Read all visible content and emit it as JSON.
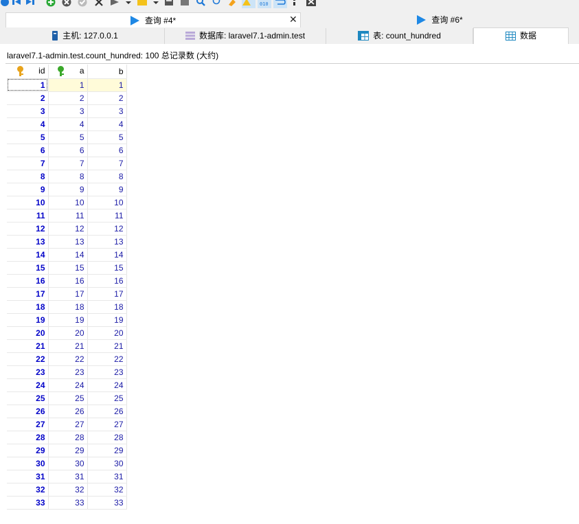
{
  "query_tabs": [
    {
      "label": "查询 #4*",
      "active": true
    },
    {
      "label": "查询 #6*",
      "active": false
    }
  ],
  "info_tabs": [
    {
      "label": "主机: 127.0.0.1",
      "icon": "server-icon"
    },
    {
      "label": "数据库: laravel7.1-admin.test",
      "icon": "database-icon"
    },
    {
      "label": "表: count_hundred",
      "icon": "table-icon"
    },
    {
      "label": "数据",
      "icon": "grid-icon",
      "active": true
    }
  ],
  "status_text": "laravel7.1-admin.test.count_hundred: 100 总记录数 (大约)",
  "columns": [
    "id",
    "a",
    "b"
  ],
  "rows": [
    [
      "1",
      "1",
      "1"
    ],
    [
      "2",
      "2",
      "2"
    ],
    [
      "3",
      "3",
      "3"
    ],
    [
      "4",
      "4",
      "4"
    ],
    [
      "5",
      "5",
      "5"
    ],
    [
      "6",
      "6",
      "6"
    ],
    [
      "7",
      "7",
      "7"
    ],
    [
      "8",
      "8",
      "8"
    ],
    [
      "9",
      "9",
      "9"
    ],
    [
      "10",
      "10",
      "10"
    ],
    [
      "11",
      "11",
      "11"
    ],
    [
      "12",
      "12",
      "12"
    ],
    [
      "13",
      "13",
      "13"
    ],
    [
      "14",
      "14",
      "14"
    ],
    [
      "15",
      "15",
      "15"
    ],
    [
      "16",
      "16",
      "16"
    ],
    [
      "17",
      "17",
      "17"
    ],
    [
      "18",
      "18",
      "18"
    ],
    [
      "19",
      "19",
      "19"
    ],
    [
      "20",
      "20",
      "20"
    ],
    [
      "21",
      "21",
      "21"
    ],
    [
      "22",
      "22",
      "22"
    ],
    [
      "23",
      "23",
      "23"
    ],
    [
      "24",
      "24",
      "24"
    ],
    [
      "25",
      "25",
      "25"
    ],
    [
      "26",
      "26",
      "26"
    ],
    [
      "27",
      "27",
      "27"
    ],
    [
      "28",
      "28",
      "28"
    ],
    [
      "29",
      "29",
      "29"
    ],
    [
      "30",
      "30",
      "30"
    ],
    [
      "31",
      "31",
      "31"
    ],
    [
      "32",
      "32",
      "32"
    ],
    [
      "33",
      "33",
      "33"
    ]
  ],
  "colors": {
    "id_text": "#0000c8",
    "value_text": "#1a1aa6",
    "selected_row": "#fffbd9",
    "play_blue": "#1e88e5"
  }
}
